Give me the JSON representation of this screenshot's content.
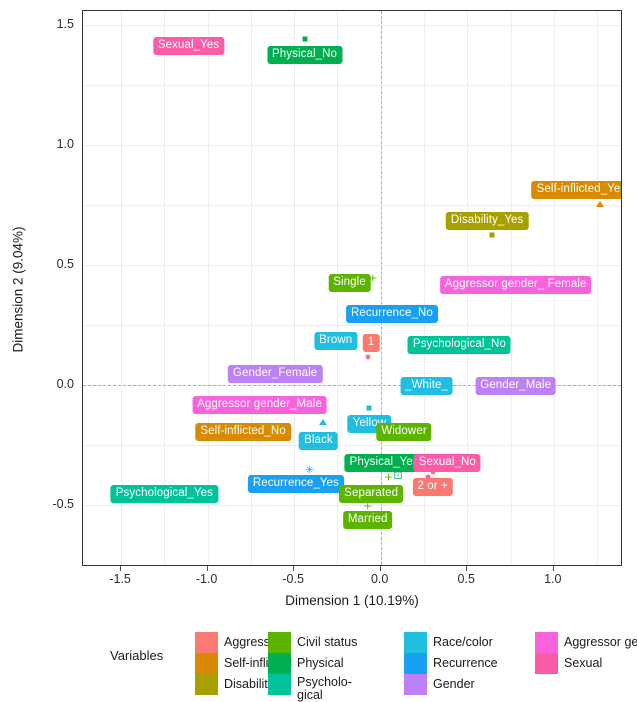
{
  "chart_data": {
    "type": "scatter",
    "title": "",
    "xlabel": "Dimension 1 (10.19%)",
    "ylabel": "Dimension 2 (9.04%)",
    "xlim": [
      -1.72,
      1.4
    ],
    "ylim": [
      -0.76,
      1.56
    ],
    "xticks": [
      -1.5,
      -1.0,
      -0.5,
      0.0,
      0.5,
      1.0
    ],
    "xticklabels": [
      "-1.5",
      "-1.0",
      "-0.5",
      "0.0",
      "0.5",
      "1.0"
    ],
    "yticks": [
      -0.5,
      0.0,
      0.5,
      1.0,
      1.5
    ],
    "yticklabels": [
      "-0.5",
      "0.0",
      "0.5",
      "1.0",
      "1.5"
    ],
    "grid": true,
    "zero_lines": {
      "x": 0.0,
      "y": 0.0,
      "style": "dashed"
    },
    "legend": {
      "position": "bottom",
      "title": "Variables"
    },
    "points": [
      {
        "label": "Sexual_Yes",
        "x": -1.11,
        "y": 1.415,
        "group": "Sexual",
        "color": "#FA5CA8",
        "marker": "none",
        "mx": -0.92,
        "my": 1.5
      },
      {
        "label": "Physical_No",
        "x": -0.44,
        "y": 1.375,
        "group": "Physical",
        "color": "#00B050",
        "marker": "square",
        "mx": -0.44,
        "my": 1.445
      },
      {
        "label": "Self-inflicted_Yes",
        "x": 1.16,
        "y": 0.815,
        "group": "Self-inflicted",
        "color": "#D88A00",
        "marker": "tri",
        "mx": 1.265,
        "my": 0.755
      },
      {
        "label": "Disability_Yes",
        "x": 0.615,
        "y": 0.685,
        "group": "Disability",
        "color": "#A8A000",
        "marker": "square",
        "mx": 0.645,
        "my": 0.625
      },
      {
        "label": "Single",
        "x": -0.18,
        "y": 0.425,
        "group": "Civil status",
        "color": "#5CB400",
        "marker": "plus",
        "mx": -0.045,
        "my": 0.445
      },
      {
        "label": "Aggressor gender_ Female",
        "x": 0.78,
        "y": 0.415,
        "group": "Aggressor gender",
        "color": "#F862DC",
        "marker": "none",
        "mx": 0.73,
        "my": 0.415
      },
      {
        "label": "Recurrence_No",
        "x": 0.065,
        "y": 0.295,
        "group": "Recurrence",
        "color": "#19A0F0",
        "marker": "none",
        "mx": 0.065,
        "my": 0.295
      },
      {
        "label": "Brown",
        "x": -0.26,
        "y": 0.185,
        "group": "Race/color",
        "color": "#20BEE0",
        "marker": "none",
        "mx": -0.26,
        "my": 0.185
      },
      {
        "label": "1",
        "x": -0.055,
        "y": 0.175,
        "group": "Aggressors",
        "color": "#FA7A72",
        "marker": "circle",
        "mx": -0.075,
        "my": 0.115
      },
      {
        "label": "Psychological_No",
        "x": 0.455,
        "y": 0.165,
        "group": "Psychological",
        "color": "#00C39A",
        "marker": "ast",
        "mx": 0.275,
        "my": 0.185
      },
      {
        "label": "Gender_Female",
        "x": -0.61,
        "y": 0.045,
        "group": "Gender",
        "color": "#BE80F5",
        "marker": "none",
        "mx": -0.61,
        "my": 0.045
      },
      {
        "label": "_White_",
        "x": 0.265,
        "y": -0.005,
        "group": "Race/color",
        "color": "#20BEE0",
        "marker": "none",
        "mx": 0.265,
        "my": -0.005
      },
      {
        "label": "Gender_Male",
        "x": 0.78,
        "y": -0.005,
        "group": "Gender",
        "color": "#BE80F5",
        "marker": "none",
        "mx": 0.78,
        "my": -0.005
      },
      {
        "label": "Aggressor gender_Male",
        "x": -0.7,
        "y": -0.085,
        "group": "Aggressor gender",
        "color": "#F862DC",
        "marker": "none",
        "mx": -0.7,
        "my": -0.085
      },
      {
        "label": "Yellow",
        "x": -0.065,
        "y": -0.165,
        "group": "Race/color",
        "color": "#20BEE0",
        "marker": "square",
        "mx": -0.065,
        "my": -0.095
      },
      {
        "label": "Widower",
        "x": 0.135,
        "y": -0.195,
        "group": "Civil status",
        "color": "#5CB400",
        "marker": "plus",
        "mx": 0.025,
        "my": -0.155
      },
      {
        "label": "Self-inflicted_No",
        "x": -0.795,
        "y": -0.195,
        "group": "Self-inflicted",
        "color": "#D88A00",
        "marker": "none",
        "mx": -0.795,
        "my": -0.195
      },
      {
        "label": "Black",
        "x": -0.36,
        "y": -0.235,
        "group": "Race/color",
        "color": "#20BEE0",
        "marker": "tri",
        "mx": -0.335,
        "my": -0.155
      },
      {
        "label": "Physical_Yes",
        "x": 0.02,
        "y": -0.325,
        "group": "Physical",
        "color": "#00B050",
        "marker": "box",
        "mx": 0.1,
        "my": -0.375
      },
      {
        "label": "Sexual_No",
        "x": 0.385,
        "y": -0.325,
        "group": "Sexual",
        "color": "#FA5CA8",
        "marker": "circle",
        "mx": 0.275,
        "my": -0.385
      },
      {
        "label": "Recurrence_Yes",
        "x": -0.49,
        "y": -0.415,
        "group": "Recurrence",
        "color": "#19A0F0",
        "marker": "ast",
        "mx": -0.41,
        "my": -0.355
      },
      {
        "label": "2 or +",
        "x": 0.3,
        "y": -0.425,
        "group": "Aggressors",
        "color": "#FA7A72",
        "marker": "circle",
        "mx": 0.305,
        "my": -0.365
      },
      {
        "label": "Separated",
        "x": -0.055,
        "y": -0.455,
        "group": "Civil status",
        "color": "#5CB400",
        "marker": "plus",
        "mx": 0.045,
        "my": -0.385
      },
      {
        "label": "Psychological_Yes",
        "x": -1.25,
        "y": -0.455,
        "group": "Psychological",
        "color": "#00C39A",
        "marker": "none",
        "mx": -1.25,
        "my": -0.455
      },
      {
        "label": "Married",
        "x": -0.075,
        "y": -0.565,
        "group": "Civil status",
        "color": "#5CB400",
        "marker": "plus",
        "mx": -0.075,
        "my": -0.505
      }
    ]
  },
  "legend": {
    "title": "Variables",
    "columns": [
      {
        "swatches": [
          "#FA7A72",
          "#D88A00",
          "#A8A000"
        ],
        "labels": [
          "Aggressors",
          "Self-inflicted",
          "Disability"
        ]
      },
      {
        "swatches": [
          "#5CB400",
          "#00B050",
          "#00C39A"
        ],
        "labels": [
          "Civil status",
          "Physical",
          "Psycholo-\ngical"
        ]
      },
      {
        "swatches": [
          "#20BEE0",
          "#19A0F0",
          "#BE80F5"
        ],
        "labels": [
          "Race/color",
          "Recurrence",
          "Gender"
        ]
      },
      {
        "swatches": [
          "#F862DC",
          "#FA5CA8"
        ],
        "labels": [
          "Aggressor gender",
          "Sexual"
        ]
      }
    ]
  }
}
